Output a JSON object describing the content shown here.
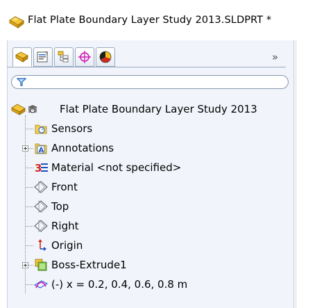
{
  "window": {
    "title": "Flat Plate Boundary Layer Study 2013.SLDPRT *"
  },
  "tabs": [
    {
      "name": "feature-manager",
      "icon": "feature-manager-icon"
    },
    {
      "name": "property-manager",
      "icon": "property-manager-icon"
    },
    {
      "name": "configuration-manager",
      "icon": "configuration-manager-icon"
    },
    {
      "name": "dimxpert-manager",
      "icon": "dimxpert-icon"
    },
    {
      "name": "display-manager",
      "icon": "display-manager-icon"
    }
  ],
  "tabbar": {
    "overflow": "»"
  },
  "filter": {
    "icon": "funnel-icon"
  },
  "tree": {
    "root": "Flat Plate Boundary Layer Study 2013",
    "items": [
      {
        "label": "Sensors",
        "icon": "sensors-icon"
      },
      {
        "label": "Annotations",
        "icon": "annotations-icon"
      },
      {
        "label": "Material <not specified>",
        "icon": "material-icon"
      },
      {
        "label": "Front",
        "icon": "plane-icon"
      },
      {
        "label": "Top",
        "icon": "plane-icon"
      },
      {
        "label": "Right",
        "icon": "plane-icon"
      },
      {
        "label": "Origin",
        "icon": "origin-icon"
      },
      {
        "label": "Boss-Extrude1",
        "icon": "boss-extrude-icon"
      },
      {
        "label": "(-) x = 0.2, 0.4, 0.6, 0.8 m",
        "icon": "sketch-icon"
      }
    ]
  },
  "colors": {
    "panel_bg": "#f1f5fb",
    "accent_blue": "#2a6fc9",
    "tab_border": "#9aa9bf"
  }
}
